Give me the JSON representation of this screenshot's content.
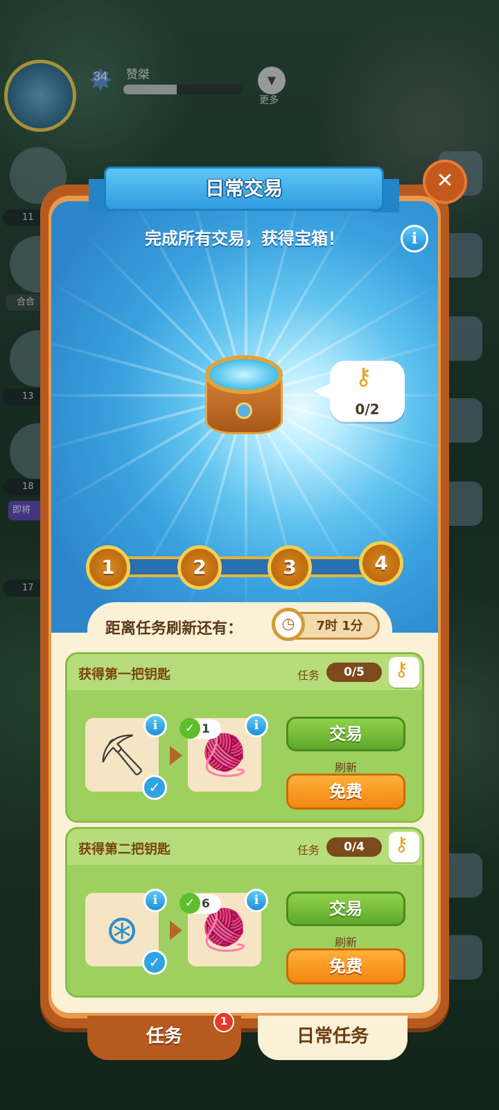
{
  "hud": {
    "level": "34",
    "player_name": "赞桀",
    "xp_progress_percent": 45,
    "more_label": "更多",
    "side_labels": [
      "合合",
      "即将"
    ],
    "timers": [
      "11",
      "13",
      "18",
      "17"
    ]
  },
  "dialog": {
    "title": "日常交易",
    "subtitle": "完成所有交易，获得宝箱！",
    "close_icon": "close-icon",
    "key_progress": "0/2",
    "steps": [
      "1",
      "2",
      "3",
      "4"
    ],
    "refresh_label": "距离任务刷新还有：",
    "refresh_timer": "7时 1分"
  },
  "tasks": [
    {
      "title": "获得第一把钥匙",
      "progress_label": "任务",
      "progress": "0/5",
      "give_item": "shovel",
      "receive_item": "yarn-balls",
      "receive_qty": "1",
      "trade_label": "交易",
      "refresh_label": "刷新",
      "free_label": "免费"
    },
    {
      "title": "获得第二把钥匙",
      "progress_label": "任务",
      "progress": "0/4",
      "give_item": "hose-reel",
      "receive_item": "blue-yarn-ball",
      "receive_qty": "6",
      "trade_label": "交易",
      "refresh_label": "刷新",
      "free_label": "免费"
    }
  ],
  "tabs": [
    {
      "label": "任务",
      "badge": "1"
    },
    {
      "label": "日常任务"
    }
  ],
  "colors": {
    "panel_orange": "#b65a1f",
    "sky_blue": "#3aa2df",
    "card_green": "#9ed05f",
    "trade_green": "#5ea92a",
    "free_orange": "#f3860f"
  }
}
